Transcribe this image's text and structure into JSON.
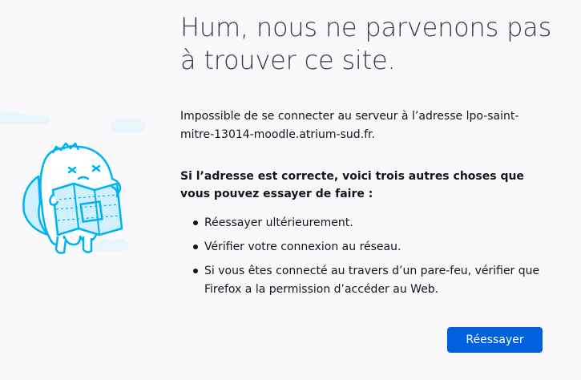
{
  "error_page": {
    "title": "Hum, nous ne parvenons pas à trouver ce site.",
    "description": "Impossible de se connecter au serveur à l’adresse lpo-saint-mitre-13014-moodle.atrium-sud.fr.",
    "advice_title": "Si l’adresse est correcte, voici trois autres choses que vous pouvez essayer de faire :",
    "advice_items": [
      {
        "text": "Réessayer ultérieurement."
      },
      {
        "text": "Vérifier votre connexion au réseau."
      },
      {
        "text": "Si vous êtes connecté au travers d’un pare-feu, vérifier que Firefox a la permission d’accéder au Web."
      }
    ],
    "retry_label": "Réessayer"
  },
  "colors": {
    "background": "#f9f9fb",
    "text": "#15141a",
    "title": "#3a3944",
    "button": "#0061e0",
    "illustration_stroke": "#00b3f4",
    "illustration_fill": "#cff0fc"
  },
  "illustration": "lost-map-monster-icon"
}
